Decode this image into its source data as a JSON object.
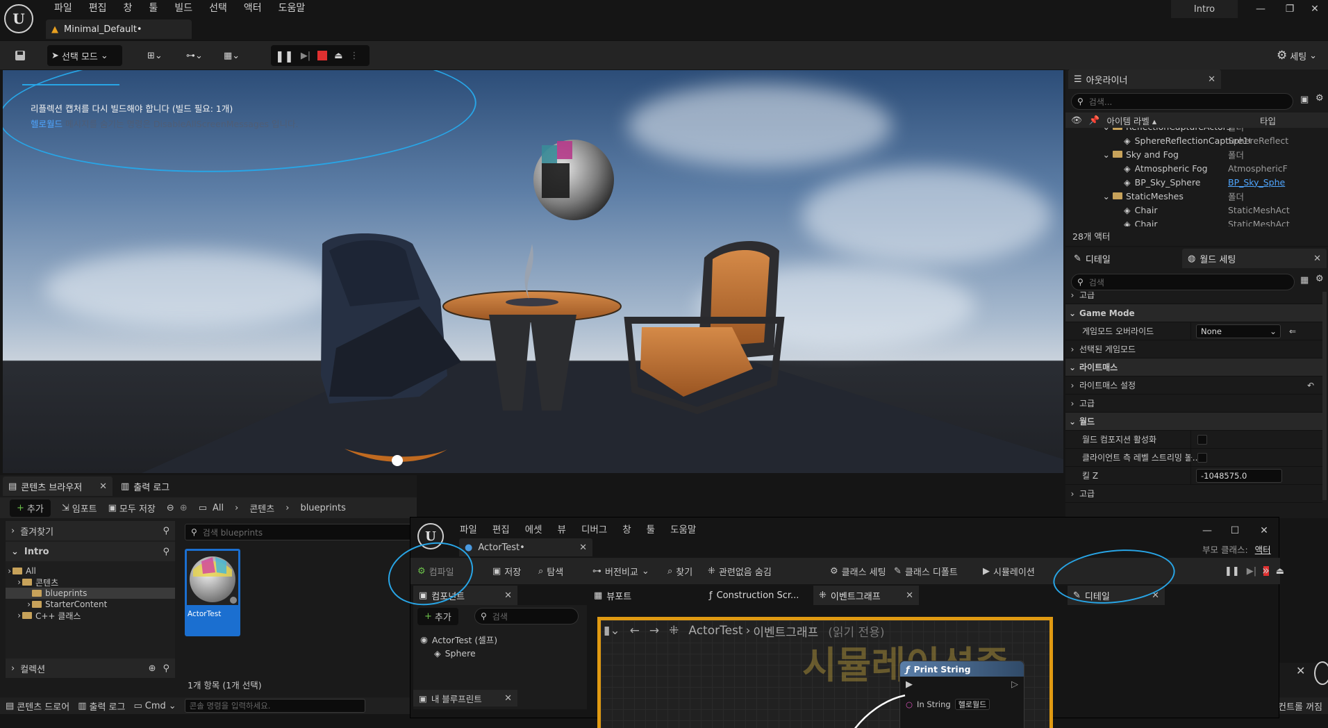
{
  "app": {
    "menu": [
      "파일",
      "편집",
      "창",
      "툴",
      "빌드",
      "선택",
      "액터",
      "도움말"
    ],
    "doc_tab": "Minimal_Default•",
    "window_title": "Intro"
  },
  "toolbar": {
    "select_mode": "선택 모드",
    "settings": "세팅"
  },
  "viewport": {
    "message_line1": "리플렉션 캡처를 다시 빌드해야 합니다 (빌드 필요: 1개)",
    "message_link": "헬로월드",
    "message_hint": "메시지를 숨기는 명령은 DisableAllScreenMessages 입니다."
  },
  "outliner": {
    "tab": "아웃라이너",
    "search_placeholder": "검색...",
    "col_label": "아이템 라벨 ▴",
    "col_type": "타입",
    "rows": [
      {
        "label": "ReflectionCaptureActors",
        "type": "폴더",
        "indent": 3,
        "kind": "folder"
      },
      {
        "label": "SphereReflectionCapture10",
        "type": "SphereReflect",
        "indent": 4,
        "kind": "actor"
      },
      {
        "label": "Sky and Fog",
        "type": "폴더",
        "indent": 3,
        "kind": "folder"
      },
      {
        "label": "Atmospheric Fog",
        "type": "AtmosphericF",
        "indent": 4,
        "kind": "actor"
      },
      {
        "label": "BP_Sky_Sphere",
        "type": "BP_Sky_Sphe",
        "indent": 4,
        "kind": "actor",
        "link": true
      },
      {
        "label": "StaticMeshes",
        "type": "폴더",
        "indent": 3,
        "kind": "folder"
      },
      {
        "label": "Chair",
        "type": "StaticMeshAct",
        "indent": 4,
        "kind": "actor"
      },
      {
        "label": "Chair",
        "type": "StaticMeshAct",
        "indent": 4,
        "kind": "actor"
      }
    ],
    "count": "28개 액터"
  },
  "details": {
    "tab1": "디테일",
    "tab2": "월드 세팅",
    "search_placeholder": "검색",
    "rows": [
      {
        "label": "고급",
        "type": "sub"
      },
      {
        "label": "Game Mode",
        "type": "head"
      },
      {
        "label": "게임모드 오버라이드",
        "type": "dropdown",
        "value": "None"
      },
      {
        "label": "선택된 게임모드",
        "type": "sub"
      },
      {
        "label": "라이트매스",
        "type": "head"
      },
      {
        "label": "라이트매스 설정",
        "type": "sub"
      },
      {
        "label": "고급",
        "type": "sub"
      },
      {
        "label": "월드",
        "type": "head"
      },
      {
        "label": "월드 컴포지션 활성화",
        "type": "check"
      },
      {
        "label": "클라이언트 측 레벨 스트리밍 볼...",
        "type": "check"
      },
      {
        "label": "킬 Z",
        "type": "text",
        "value": "-1048575.0"
      },
      {
        "label": "고급",
        "type": "sub"
      }
    ]
  },
  "content_browser": {
    "tab": "콘텐츠 브라우저",
    "tab2": "출력 로그",
    "add": "추가",
    "import": "임포트",
    "save_all": "모두 저장",
    "breadcrumb": [
      "All",
      "콘텐츠",
      "blueprints"
    ],
    "settings": "세팅",
    "favorites": "즐겨찾기",
    "project": "Intro",
    "tree": [
      {
        "label": "All",
        "indent": 0
      },
      {
        "label": "콘텐츠",
        "indent": 1
      },
      {
        "label": "blueprints",
        "indent": 2,
        "selected": true
      },
      {
        "label": "StarterContent",
        "indent": 2
      },
      {
        "label": "C++ 클래스",
        "indent": 1
      }
    ],
    "collections": "컬렉션",
    "search_placeholder": "검색 blueprints",
    "asset_name": "ActorTest",
    "status": "1개 항목 (1개 선택)"
  },
  "bottom_bar": {
    "drawer": "콘텐츠 드로어",
    "log": "출력 로그",
    "cmd": "Cmd",
    "console_placeholder": "콘솔 명령을 입력하세요.",
    "right_text": "소스 컨트롤 꺼짐"
  },
  "blueprint": {
    "menu": [
      "파일",
      "편집",
      "에셋",
      "뷰",
      "디버그",
      "창",
      "툴",
      "도움말"
    ],
    "tab": "ActorTest•",
    "parent_label": "부모 클래스:",
    "parent_value": "액터",
    "toolbar": [
      "컴파일",
      "저장",
      "탐색",
      "버전비교",
      "찾기",
      "관련없음 숨김",
      "클래스 세팅",
      "클래스 디폴트",
      "시뮬레이션"
    ],
    "components_tab": "컴포넌트",
    "add": "추가",
    "search_placeholder": "검색",
    "components": [
      "ActorTest (셀프)",
      "Sphere"
    ],
    "my_blueprint": "내 블루프린트",
    "viewport_tab": "뷰포트",
    "construction_tab": "Construction Scr...",
    "event_tab": "이벤트그래프",
    "details_tab": "디테일",
    "graph_breadcrumb": "ActorTest",
    "graph_title": "이벤트그래프",
    "graph_readonly": "(읽기 전용)",
    "simulating": "시뮬레이션중",
    "node_title": "Print String",
    "node_pin": "In String",
    "node_value": "헬로월드"
  },
  "colors": {
    "accent": "#28a5e6",
    "stop": "#e03030",
    "graph_border": "#e09a12"
  }
}
